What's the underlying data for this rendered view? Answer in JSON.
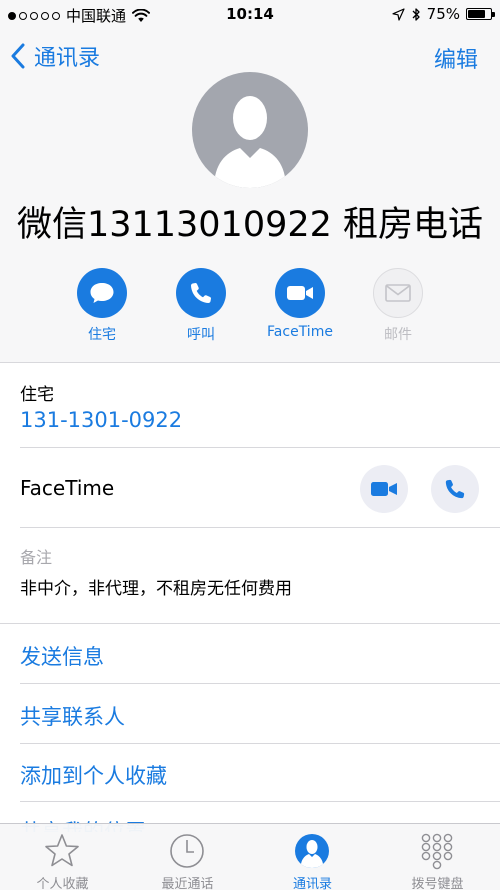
{
  "status_bar": {
    "carrier": "中国联通",
    "time": "10:14",
    "battery": "75%",
    "battery_level": 0.75
  },
  "nav": {
    "back_label": "通讯录",
    "edit_label": "编辑"
  },
  "contact": {
    "name": "微信13113010922 租房电话"
  },
  "actions": [
    {
      "label": "住宅",
      "icon": "message-icon",
      "enabled": true
    },
    {
      "label": "呼叫",
      "icon": "phone-icon",
      "enabled": true
    },
    {
      "label": "FaceTime",
      "icon": "video-icon",
      "enabled": true
    },
    {
      "label": "邮件",
      "icon": "mail-icon",
      "enabled": false
    }
  ],
  "phone": {
    "label": "住宅",
    "number": "131-1301-0922"
  },
  "facetime": {
    "label": "FaceTime"
  },
  "notes": {
    "label": "备注",
    "text": "非中介，非代理，不租房无任何费用"
  },
  "links": {
    "send_message": "发送信息",
    "share_contact": "共享联系人",
    "add_favorite": "添加到个人收藏",
    "share_location": "共享我的位置"
  },
  "tab_bar": {
    "tabs": [
      {
        "label": "个人收藏",
        "icon": "star-icon",
        "active": false
      },
      {
        "label": "最近通话",
        "icon": "clock-icon",
        "active": false
      },
      {
        "label": "通讯录",
        "icon": "person-icon",
        "active": true
      },
      {
        "label": "拨号键盘",
        "icon": "keypad-icon",
        "active": false
      }
    ]
  },
  "colors": {
    "accent": "#1a7be0",
    "avatar_gray": "#a3a6ae",
    "header_bg": "#f7f7f8",
    "separator": "#d8d8dc"
  }
}
